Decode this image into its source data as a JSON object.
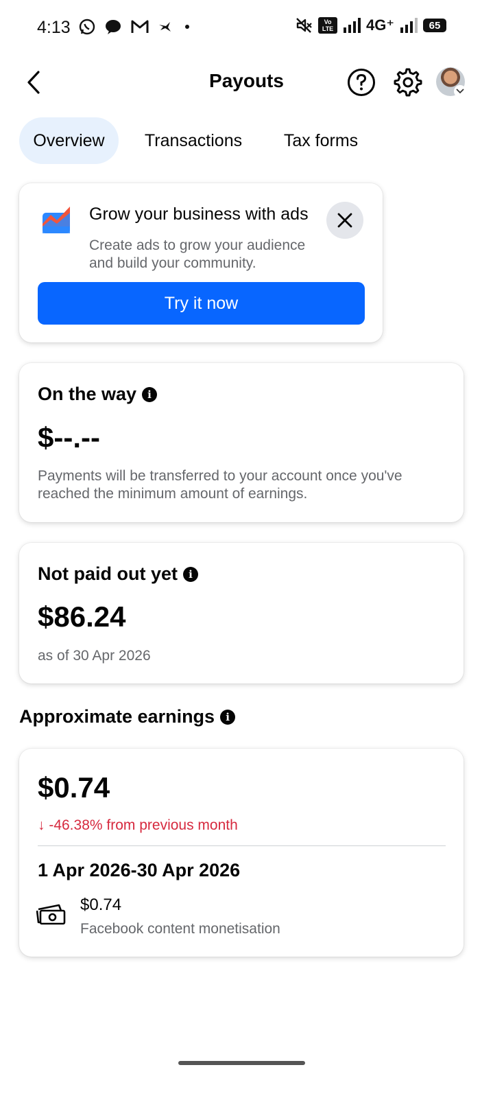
{
  "status_bar": {
    "time": "4:13",
    "network": "4G⁺",
    "battery": "65",
    "volte": "Vo LTE"
  },
  "header": {
    "title": "Payouts"
  },
  "tabs": [
    {
      "label": "Overview",
      "active": true
    },
    {
      "label": "Transactions",
      "active": false
    },
    {
      "label": "Tax forms",
      "active": false
    }
  ],
  "promo": {
    "title": "Grow your business with ads",
    "line1": "Create ads to grow your audience",
    "line2": "and build your community.",
    "button": "Try it now"
  },
  "on_the_way": {
    "title": "On the way",
    "amount": "$--.--",
    "line1": "Payments will be transferred to your account once you've",
    "line2": "reached the minimum amount of earnings."
  },
  "not_paid": {
    "title": "Not paid out yet",
    "amount": "$86.24",
    "as_of": "as of 30 Apr 2026"
  },
  "approx": {
    "section_title": "Approximate earnings",
    "amount": "$0.74",
    "change": "↓ -46.38% from previous month",
    "period": "1 Apr 2026-30 Apr 2026",
    "item_amount": "$0.74",
    "item_label": "Facebook content monetisation"
  },
  "colors": {
    "accent": "#0866ff",
    "tab_active_bg": "#e7f1fd",
    "negative": "#d6293e",
    "muted": "#65676b"
  },
  "icons": [
    "back-arrow-icon",
    "help-icon",
    "settings-icon",
    "info-icon",
    "close-icon",
    "cash-icon",
    "ads-chart-icon"
  ]
}
